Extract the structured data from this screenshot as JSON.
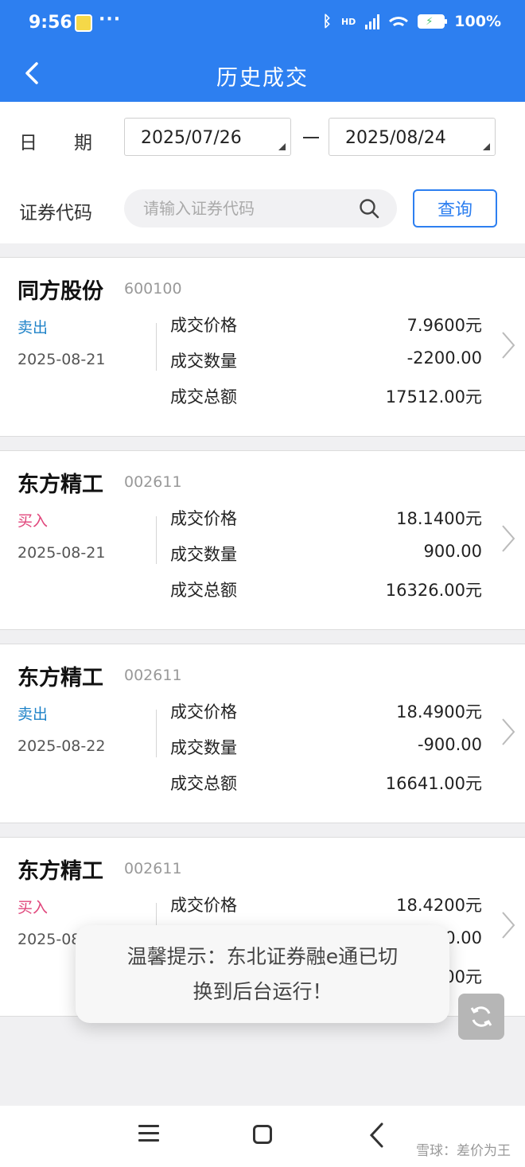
{
  "status_bar": {
    "time": "9:56",
    "dots": "···",
    "network": "HD",
    "battery": "100%"
  },
  "app_bar": {
    "title": "历史成交"
  },
  "filters": {
    "date_label_1": "日",
    "date_label_2": "期",
    "date_start": "2025/07/26",
    "date_end": "2025/08/24",
    "code_label": "证券代码",
    "search_placeholder": "请输入证券代码",
    "query_label": "查询"
  },
  "labels": {
    "price": "成交价格",
    "quantity": "成交数量",
    "amount": "成交总额"
  },
  "trades": [
    {
      "name": "同方股份",
      "code": "600100",
      "side": "卖出",
      "date": "2025-08-21",
      "price": "7.9600元",
      "quantity": "-2200.00",
      "amount": "17512.00元"
    },
    {
      "name": "东方精工",
      "code": "002611",
      "side": "买入",
      "date": "2025-08-21",
      "price": "18.1400元",
      "quantity": "900.00",
      "amount": "16326.00元"
    },
    {
      "name": "东方精工",
      "code": "002611",
      "side": "卖出",
      "date": "2025-08-22",
      "price": "18.4900元",
      "quantity": "-900.00",
      "amount": "16641.00元"
    },
    {
      "name": "东方精工",
      "code": "002611",
      "side": "买入",
      "date": "2025-08",
      "price": "18.4200元",
      "quantity": ")0.00",
      "amount": "00元"
    }
  ],
  "toast": {
    "line1": "温馨提示：东北证券融e通已切",
    "line2": "换到后台运行！"
  },
  "watermark": "雪球：差价为王",
  "colors": {
    "primary": "#2d7ff0",
    "sell": "#1f83c8",
    "buy": "#e0457b"
  }
}
